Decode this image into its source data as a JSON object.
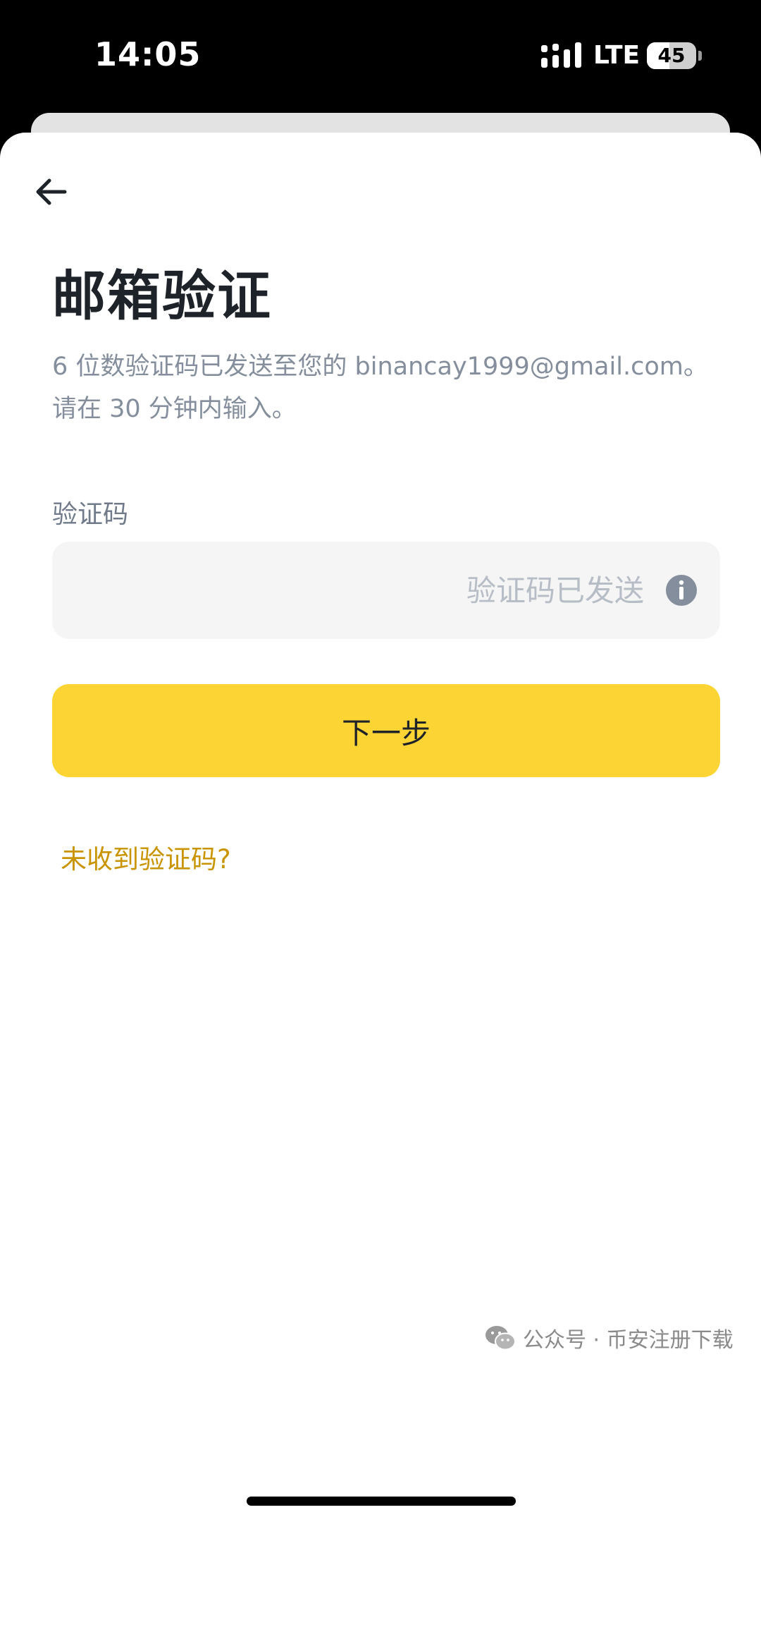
{
  "status_bar": {
    "time": "14:05",
    "network": "LTE",
    "battery_level": "45",
    "battery_fraction": 0.45
  },
  "icons": {
    "back": "arrow-left-icon",
    "info": "info-circle-icon",
    "signal": "cellular-signal-icon",
    "watermark": "wechat-icon"
  },
  "page": {
    "title": "邮箱验证",
    "subtitle": "6 位数验证码已发送至您的 binancay1999@gmail.com。请在 30 分钟内输入。"
  },
  "form": {
    "code_label": "验证码",
    "code_value": "",
    "code_placeholder": "验证码已发送"
  },
  "actions": {
    "next_label": "下一步",
    "resend_label": "未收到验证码?"
  },
  "watermark": {
    "text": "公众号 · 币安注册下载"
  },
  "colors": {
    "accent": "#fcd535",
    "link": "#c99400",
    "title": "#1e2329",
    "secondary_text": "#848e9c",
    "input_background": "#f5f5f5"
  }
}
